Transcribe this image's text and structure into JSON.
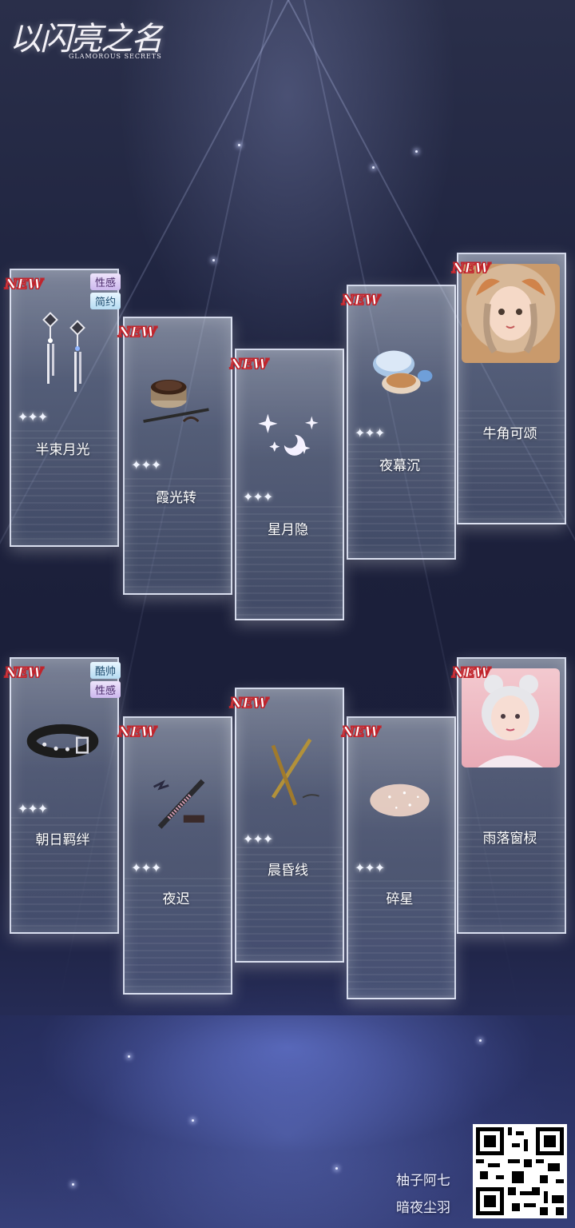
{
  "logo": {
    "title": "以闪亮之名",
    "subtitle": "GLAMOROUS SECRETS"
  },
  "row1": [
    {
      "name": "半束月光",
      "new": "NEW",
      "stars": "✦✦✦",
      "tags": [
        {
          "text": "性感",
          "style": "purple"
        },
        {
          "text": "简约",
          "style": "blue"
        }
      ],
      "icon": "earrings-icon"
    },
    {
      "name": "霞光转",
      "new": "NEW",
      "stars": "✦✦✦",
      "tags": [],
      "icon": "gel-eyeliner-pot-icon"
    },
    {
      "name": "星月隐",
      "new": "NEW",
      "stars": "✦✦✦",
      "tags": [],
      "icon": "star-moon-sparkle-icon"
    },
    {
      "name": "夜幕沉",
      "new": "NEW",
      "stars": "✦✦✦",
      "tags": [],
      "icon": "powder-compact-icon"
    },
    {
      "name": "牛角可颂",
      "new": "NEW",
      "stars": "",
      "tags": [],
      "icon": "girl-portrait-horns"
    }
  ],
  "row2": [
    {
      "name": "朝日羁绊",
      "new": "NEW",
      "stars": "✦✦✦",
      "tags": [
        {
          "text": "酷帅",
          "style": "blue"
        },
        {
          "text": "性感",
          "style": "purple"
        }
      ],
      "icon": "leather-choker-icon"
    },
    {
      "name": "夜迟",
      "new": "NEW",
      "stars": "✦✦✦",
      "tags": [],
      "icon": "liquid-eyeliner-icon"
    },
    {
      "name": "晨昏线",
      "new": "NEW",
      "stars": "✦✦✦",
      "tags": [],
      "icon": "eyebrow-pencil-icon"
    },
    {
      "name": "碎星",
      "new": "NEW",
      "stars": "✦✦✦",
      "tags": [],
      "icon": "glitter-blush-icon"
    },
    {
      "name": "雨落窗棂",
      "new": "NEW",
      "stars": "",
      "tags": [],
      "icon": "girl-portrait-silver"
    }
  ],
  "credits": {
    "line1": "柚子阿七",
    "line2": "暗夜尘羽"
  }
}
